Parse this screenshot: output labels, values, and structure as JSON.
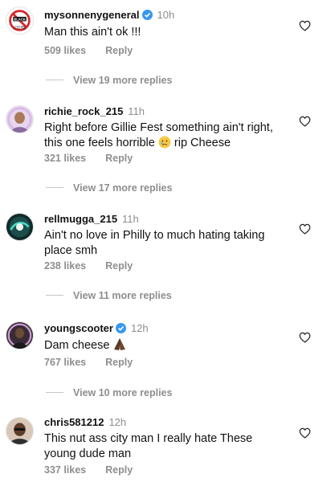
{
  "colors": {
    "text": "#111111",
    "muted": "#8e8e8e",
    "verified": "#3897f0"
  },
  "comments": [
    {
      "username": "mysonnenygeneral",
      "verified": true,
      "time": "10h",
      "text": "Man this ain't ok !!!",
      "likes": "509 likes",
      "reply": "Reply",
      "view_replies": "View 19 more replies",
      "avatar_text": [
        "BLACK",
        "I CAN'T BELL",
        "MY BROTHER"
      ]
    },
    {
      "username": "richie_rock_215",
      "verified": false,
      "time": "11h",
      "text_before": "Right before Gillie Fest something ain't right, this one feels horrible",
      "emoji": "sad-face-emoji",
      "text_after": " rip Cheese",
      "likes": "321 likes",
      "reply": "Reply",
      "view_replies": "View 17 more replies"
    },
    {
      "username": "rellmugga_215",
      "verified": false,
      "time": "11h",
      "text": "Ain't no love in Philly to much hating taking place smh",
      "likes": "238 likes",
      "reply": "Reply",
      "view_replies": "View 11 more replies"
    },
    {
      "username": "youngscooter",
      "verified": true,
      "time": "12h",
      "text": "Dam cheese",
      "emoji": "praying-hands-emoji",
      "likes": "767 likes",
      "reply": "Reply",
      "view_replies": "View 10 more replies"
    },
    {
      "username": "chris581212",
      "verified": false,
      "time": "12h",
      "text": "This nut ass city man I really hate These young dude man",
      "likes": "337 likes",
      "reply": "Reply"
    }
  ]
}
